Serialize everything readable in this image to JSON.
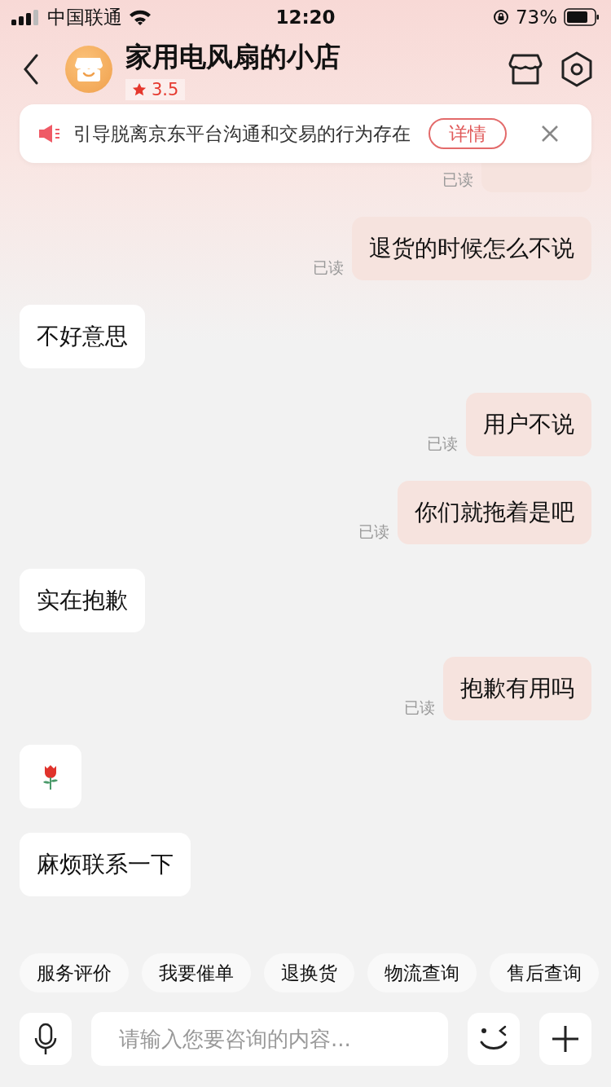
{
  "status_bar": {
    "carrier": "中国联通",
    "time": "12:20",
    "battery": "73%"
  },
  "header": {
    "title": "家用电风扇的小店",
    "rating": "3.5"
  },
  "notice": {
    "text": "引导脱离京东平台沟通和交易的行为存在",
    "button": "详情"
  },
  "messages": [
    {
      "kind": "hidden",
      "outgoing": true,
      "read": "已读"
    },
    {
      "kind": "text",
      "outgoing": true,
      "text": "退货的时候怎么不说",
      "read": "已读"
    },
    {
      "kind": "text",
      "outgoing": false,
      "text": "不好意思"
    },
    {
      "kind": "text",
      "outgoing": true,
      "text": "用户不说",
      "read": "已读"
    },
    {
      "kind": "text",
      "outgoing": true,
      "text": "你们就拖着是吧",
      "read": "已读"
    },
    {
      "kind": "text",
      "outgoing": false,
      "text": "实在抱歉"
    },
    {
      "kind": "text",
      "outgoing": true,
      "text": "抱歉有用吗",
      "read": "已读"
    },
    {
      "kind": "sticker",
      "outgoing": false
    },
    {
      "kind": "text",
      "outgoing": false,
      "text": "麻烦联系一下"
    }
  ],
  "quick_replies": [
    "服务评价",
    "我要催单",
    "退换货",
    "物流查询",
    "售后查询"
  ],
  "input": {
    "placeholder": "请输入您要咨询的内容..."
  }
}
